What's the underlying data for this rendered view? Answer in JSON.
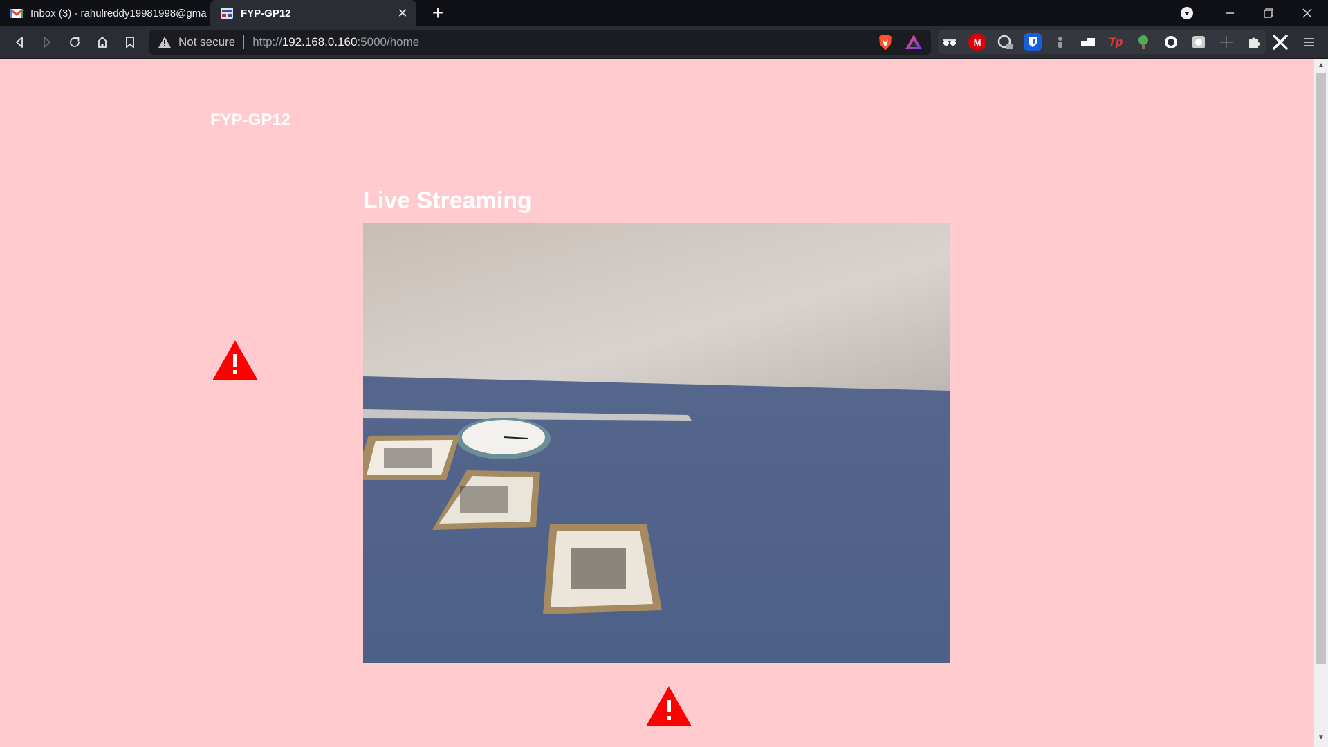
{
  "browser": {
    "tabs": [
      {
        "title": "Inbox (3) - rahulreddy19981998@gma",
        "icon": "gmail-icon",
        "active": false
      },
      {
        "title": "FYP-GP12",
        "icon": "site-favicon",
        "active": true
      }
    ],
    "new_tab_label": "+",
    "url": {
      "security_label": "Not secure",
      "scheme": "http://",
      "host": "192.168.0.160",
      "rest": ":5000/home"
    },
    "extensions": [
      "spy-icon",
      "mega-icon",
      "gauge-icon",
      "bitwarden-icon",
      "figure-icon",
      "switch-icon",
      "tp-icon",
      "tree-icon",
      "circle-icon",
      "square-icon",
      "crosshair-icon",
      "puzzle-icon",
      "x-icon"
    ]
  },
  "page": {
    "site_title": "FYP-GP12",
    "stream_heading": "Live Streaming",
    "background_color": "#ffcbcf",
    "alert_color": "#ff0000"
  }
}
